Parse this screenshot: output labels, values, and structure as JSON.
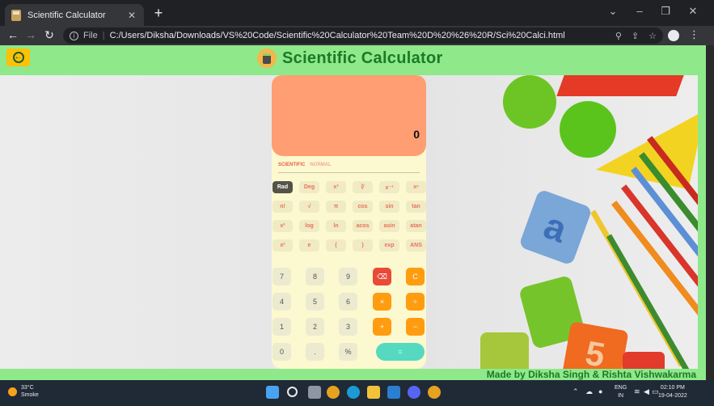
{
  "browser": {
    "tab_title": "Scientific Calculator",
    "tab_close": "✕",
    "new_tab": "+",
    "file_label": "File",
    "separator": "|",
    "url": "C:/Users/Diksha/Downloads/VS%20Code/Scientific%20Calculator%20Team%20D%20%26%20R/Sci%20Calci.html",
    "icons": [
      "back-arrow-icon",
      "forward-arrow-icon",
      "reload-icon",
      "zoom-icon",
      "share-icon",
      "star-icon",
      "profile-icon",
      "menu-icon"
    ]
  },
  "header": {
    "title": "Scientific Calculator",
    "back_icon": "←"
  },
  "calculator": {
    "display_value": "0",
    "modes": [
      "SCIENTIFIC",
      "NORMAL"
    ],
    "sci_rows": [
      [
        "Rad",
        "Deg",
        "x³",
        "∛",
        "x⁻¹",
        "xⁿ"
      ],
      [
        "n!",
        "√",
        "π",
        "cos",
        "sin",
        "tan"
      ],
      [
        "x²",
        "log",
        "ln",
        "acos",
        "asin",
        "atan"
      ],
      [
        "x²",
        "e",
        "(",
        ")",
        "exp",
        "ANS"
      ]
    ],
    "num_rows": [
      [
        "7",
        "8",
        "9",
        "⌫",
        "C"
      ],
      [
        "4",
        "5",
        "6",
        "×",
        "÷"
      ],
      [
        "1",
        "2",
        "3",
        "+",
        "−"
      ],
      [
        "0",
        ".",
        "%",
        "="
      ]
    ]
  },
  "footer": {
    "credit": "Made by Diksha Singh & Rishta Vishwakarma"
  },
  "taskbar": {
    "temperature": "33°C",
    "weather": "Smoke",
    "lang_top": "ENG",
    "lang_bottom": "IN",
    "time": "02:10 PM",
    "date": "19-04-2022"
  }
}
